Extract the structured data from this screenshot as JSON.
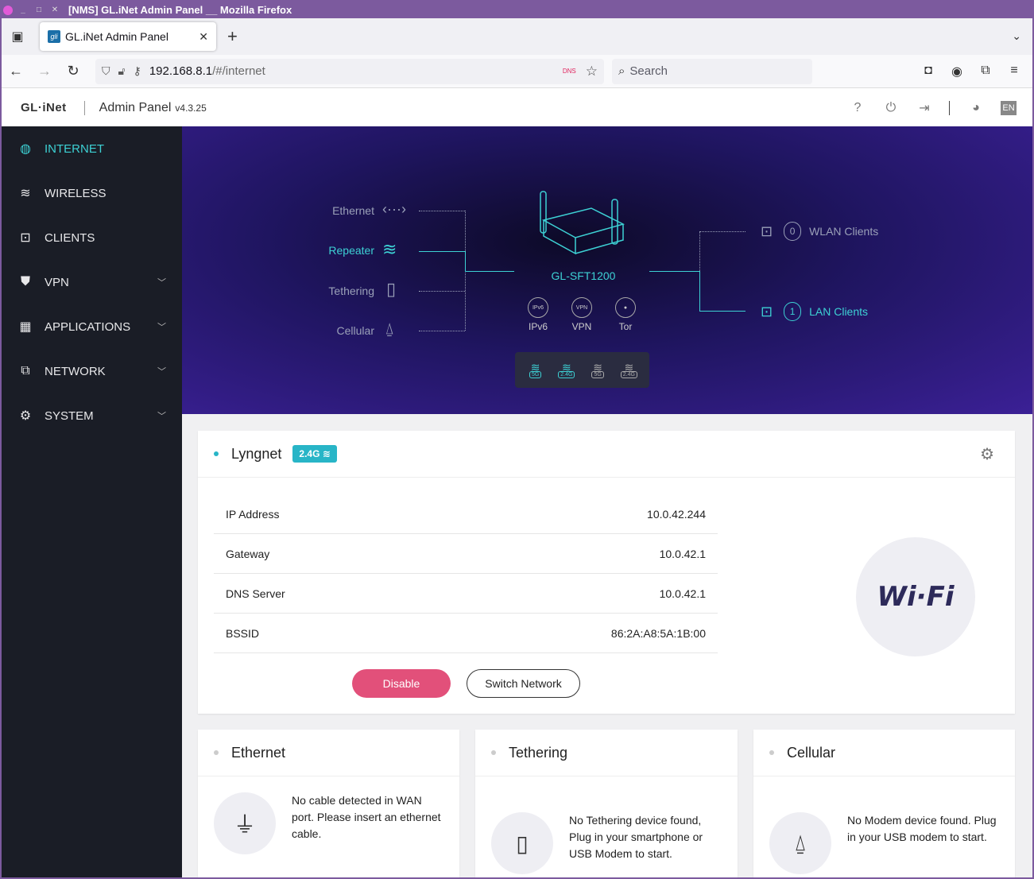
{
  "window": {
    "title": "[NMS] GL.iNet Admin Panel __ Mozilla Firefox"
  },
  "browser": {
    "tab_title": "GL.iNet Admin Panel",
    "tab_favicon": "gli",
    "url_host": "192.168.8.1",
    "url_path": "/#/internet",
    "dns_badge": "DNS",
    "search_placeholder": "Search"
  },
  "header": {
    "logo": "GL·iNet",
    "title": "Admin Panel",
    "version": "v4.3.25",
    "lang": "EN"
  },
  "sidebar": {
    "items": [
      {
        "label": "INTERNET",
        "icon": "globe-icon",
        "active": true,
        "chevron": false
      },
      {
        "label": "WIRELESS",
        "icon": "wifi-icon",
        "active": false,
        "chevron": false
      },
      {
        "label": "CLIENTS",
        "icon": "devices-icon",
        "active": false,
        "chevron": false
      },
      {
        "label": "VPN",
        "icon": "shield-icon",
        "active": false,
        "chevron": true
      },
      {
        "label": "APPLICATIONS",
        "icon": "apps-icon",
        "active": false,
        "chevron": true
      },
      {
        "label": "NETWORK",
        "icon": "network-icon",
        "active": false,
        "chevron": true
      },
      {
        "label": "SYSTEM",
        "icon": "gear-icon",
        "active": false,
        "chevron": true
      }
    ]
  },
  "topology": {
    "wan": {
      "ethernet": "Ethernet",
      "repeater": "Repeater",
      "tethering": "Tethering",
      "cellular": "Cellular"
    },
    "router_name": "GL-SFT1200",
    "features": {
      "ipv6": "IPv6",
      "vpn": "VPN",
      "tor": "Tor",
      "ipv6_badge": "IPv6",
      "vpn_badge": "VPN"
    },
    "bands": [
      "5G",
      "2.4G",
      "5G",
      "2.4G"
    ],
    "wlan_count": "0",
    "wlan_label": "WLAN Clients",
    "lan_count": "1",
    "lan_label": "LAN Clients"
  },
  "repeater": {
    "ssid": "Lyngnet",
    "band": "2.4G",
    "rows": [
      {
        "key": "IP Address",
        "value": "10.0.42.244"
      },
      {
        "key": "Gateway",
        "value": "10.0.42.1"
      },
      {
        "key": "DNS Server",
        "value": "10.0.42.1"
      },
      {
        "key": "BSSID",
        "value": "86:2A:A8:5A:1B:00"
      }
    ],
    "disable_label": "Disable",
    "switch_label": "Switch Network",
    "wifi_logo": "Wi·Fi"
  },
  "ethernet_card": {
    "title": "Ethernet",
    "message": "No cable detected in WAN port. Please insert an ethernet cable."
  },
  "tethering_card": {
    "title": "Tethering",
    "message": "No Tethering device found, Plug in your smartphone or USB Modem to start."
  },
  "cellular_card": {
    "title": "Cellular",
    "message": "No Modem device found. Plug in your USB modem to start."
  },
  "colors": {
    "accent": "#3dd1d4",
    "danger": "#e2507a",
    "sidebar": "#1a1d26"
  }
}
